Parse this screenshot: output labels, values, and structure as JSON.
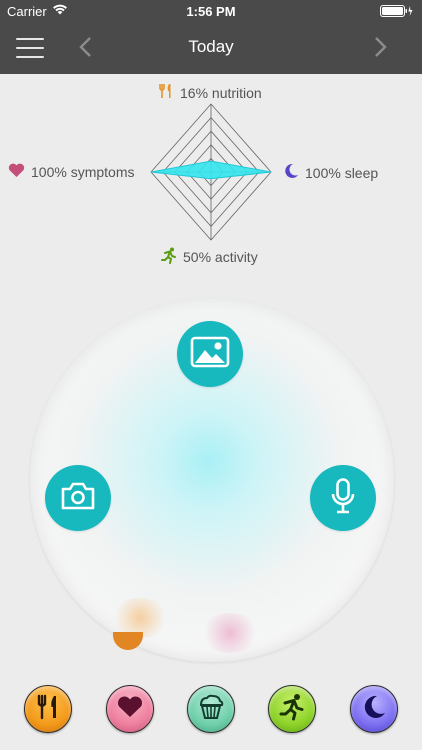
{
  "status_bar": {
    "carrier": "Carrier",
    "time": "1:56 PM"
  },
  "nav": {
    "title": "Today",
    "menu_icon": "hamburger-menu-icon",
    "prev_icon": "chevron-left-icon",
    "next_icon": "chevron-right-icon"
  },
  "radar": {
    "nutrition": {
      "label": "16% nutrition",
      "value": 16,
      "icon": "fork-knife-icon",
      "color": "#e4952a"
    },
    "symptoms": {
      "label": "100% symptoms",
      "value": 100,
      "icon": "heart-icon",
      "color": "#c44d79"
    },
    "sleep": {
      "label": "100% sleep",
      "value": 100,
      "icon": "moon-icon",
      "color": "#5546c9"
    },
    "activity": {
      "label": "50% activity",
      "value": 50,
      "icon": "runner-icon",
      "color": "#5a9d10"
    },
    "fill_color": "#34e6f0"
  },
  "actions": {
    "gallery_icon": "image-gallery-icon",
    "camera_icon": "camera-icon",
    "mic_icon": "microphone-icon",
    "accent": "#18b8bf"
  },
  "categories": [
    {
      "name": "nutrition",
      "icon": "fork-knife-icon"
    },
    {
      "name": "symptoms",
      "icon": "heart-icon"
    },
    {
      "name": "food",
      "icon": "cupcake-icon"
    },
    {
      "name": "activity",
      "icon": "runner-icon"
    },
    {
      "name": "sleep",
      "icon": "moon-icon"
    }
  ]
}
